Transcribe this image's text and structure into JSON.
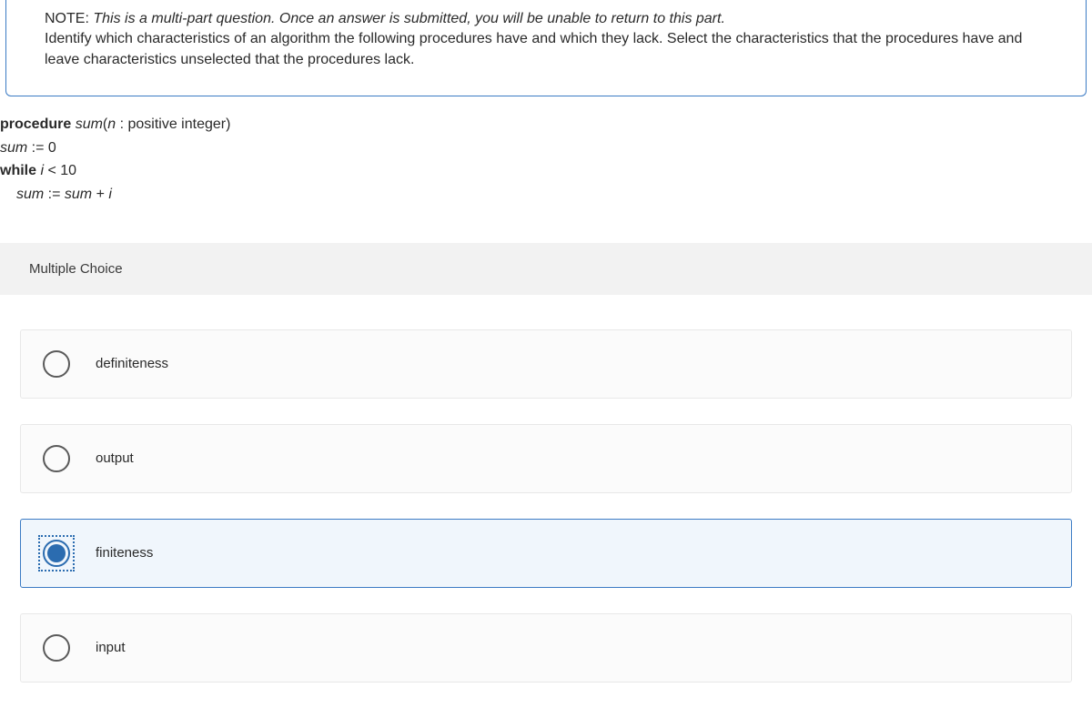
{
  "note": {
    "label": "NOTE: ",
    "italic_text": "This is a multi-part question. Once an answer is submitted, you will be unable to return to this part.",
    "body": "Identify which characteristics of an algorithm the following procedures have and which they lack. Select the characteristics that the procedures have and leave characteristics unselected that the procedures lack."
  },
  "procedure": {
    "line1_bold": "procedure ",
    "line1_ital": "sum",
    "line1_rest_open": "(",
    "line1_n": "n ",
    "line1_rest": ": positive integer)",
    "line2_sum": "sum ",
    "line2_rest": ":= 0",
    "line3_bold": "while ",
    "line3_ital": "i ",
    "line3_rest": "< 10",
    "line4_sum1": "sum ",
    "line4_mid": ":= ",
    "line4_sum2": "sum ",
    "line4_plus": "+ ",
    "line4_i": "i"
  },
  "mc_title": "Multiple Choice",
  "options": [
    {
      "label": "definiteness",
      "selected": false
    },
    {
      "label": "output",
      "selected": false
    },
    {
      "label": "finiteness",
      "selected": true
    },
    {
      "label": "input",
      "selected": false
    }
  ]
}
